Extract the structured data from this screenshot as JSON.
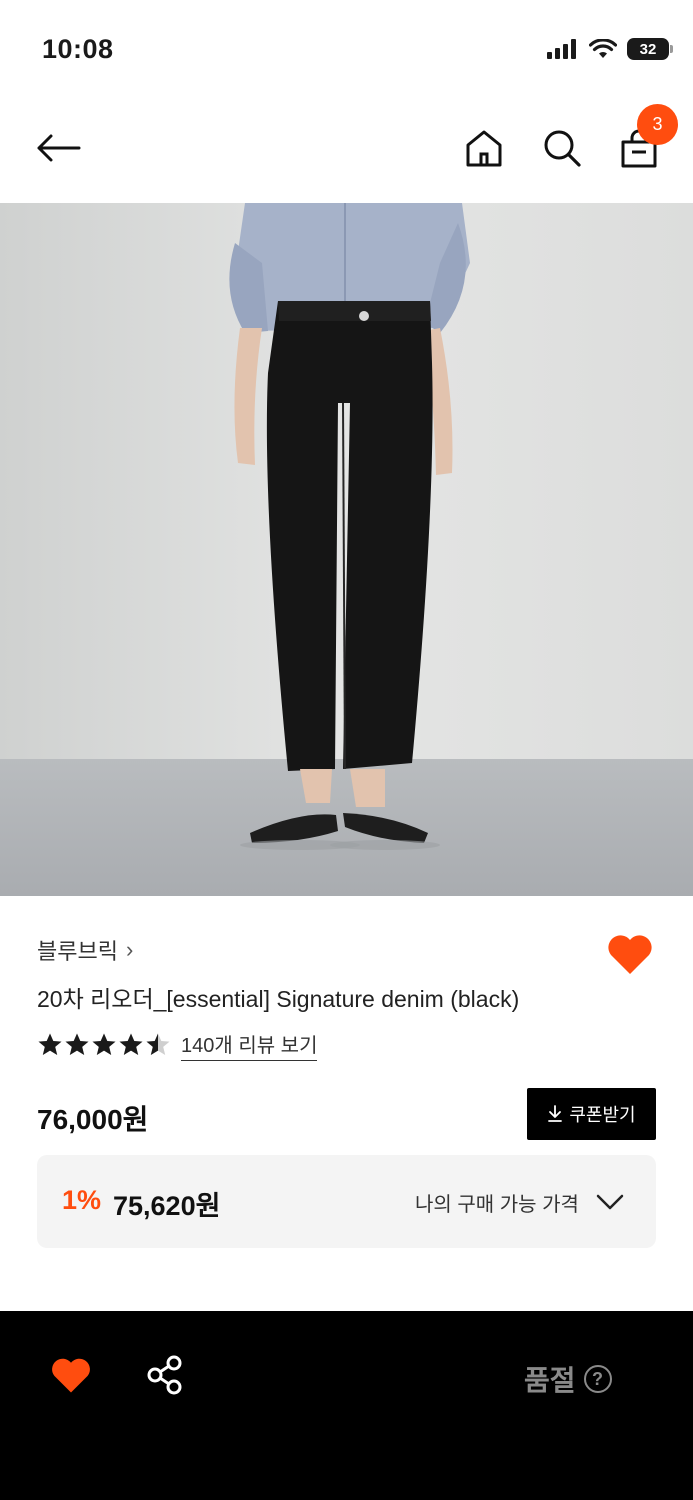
{
  "status_bar": {
    "time": "10:08",
    "battery": "32"
  },
  "nav": {
    "cart_count": "3"
  },
  "product": {
    "brand": "블루브릭",
    "brand_chevron": "›",
    "title": "20차 리오더_[essential] Signature denim (black)",
    "rating_value": 4.5,
    "rating_max": 5,
    "review_link": "140개 리뷰 보기",
    "price": "76,000원",
    "coupon_label": "쿠폰받기",
    "best_discount": "1%",
    "best_price": "75,620원",
    "best_label": "나의 구매 가능 가격",
    "wishlisted": true
  },
  "bottom_bar": {
    "soldout_label": "품절",
    "help_glyph": "?"
  },
  "colors": {
    "accent": "#ff4d0f",
    "dark": "#000000",
    "panel": "#f4f4f4"
  }
}
